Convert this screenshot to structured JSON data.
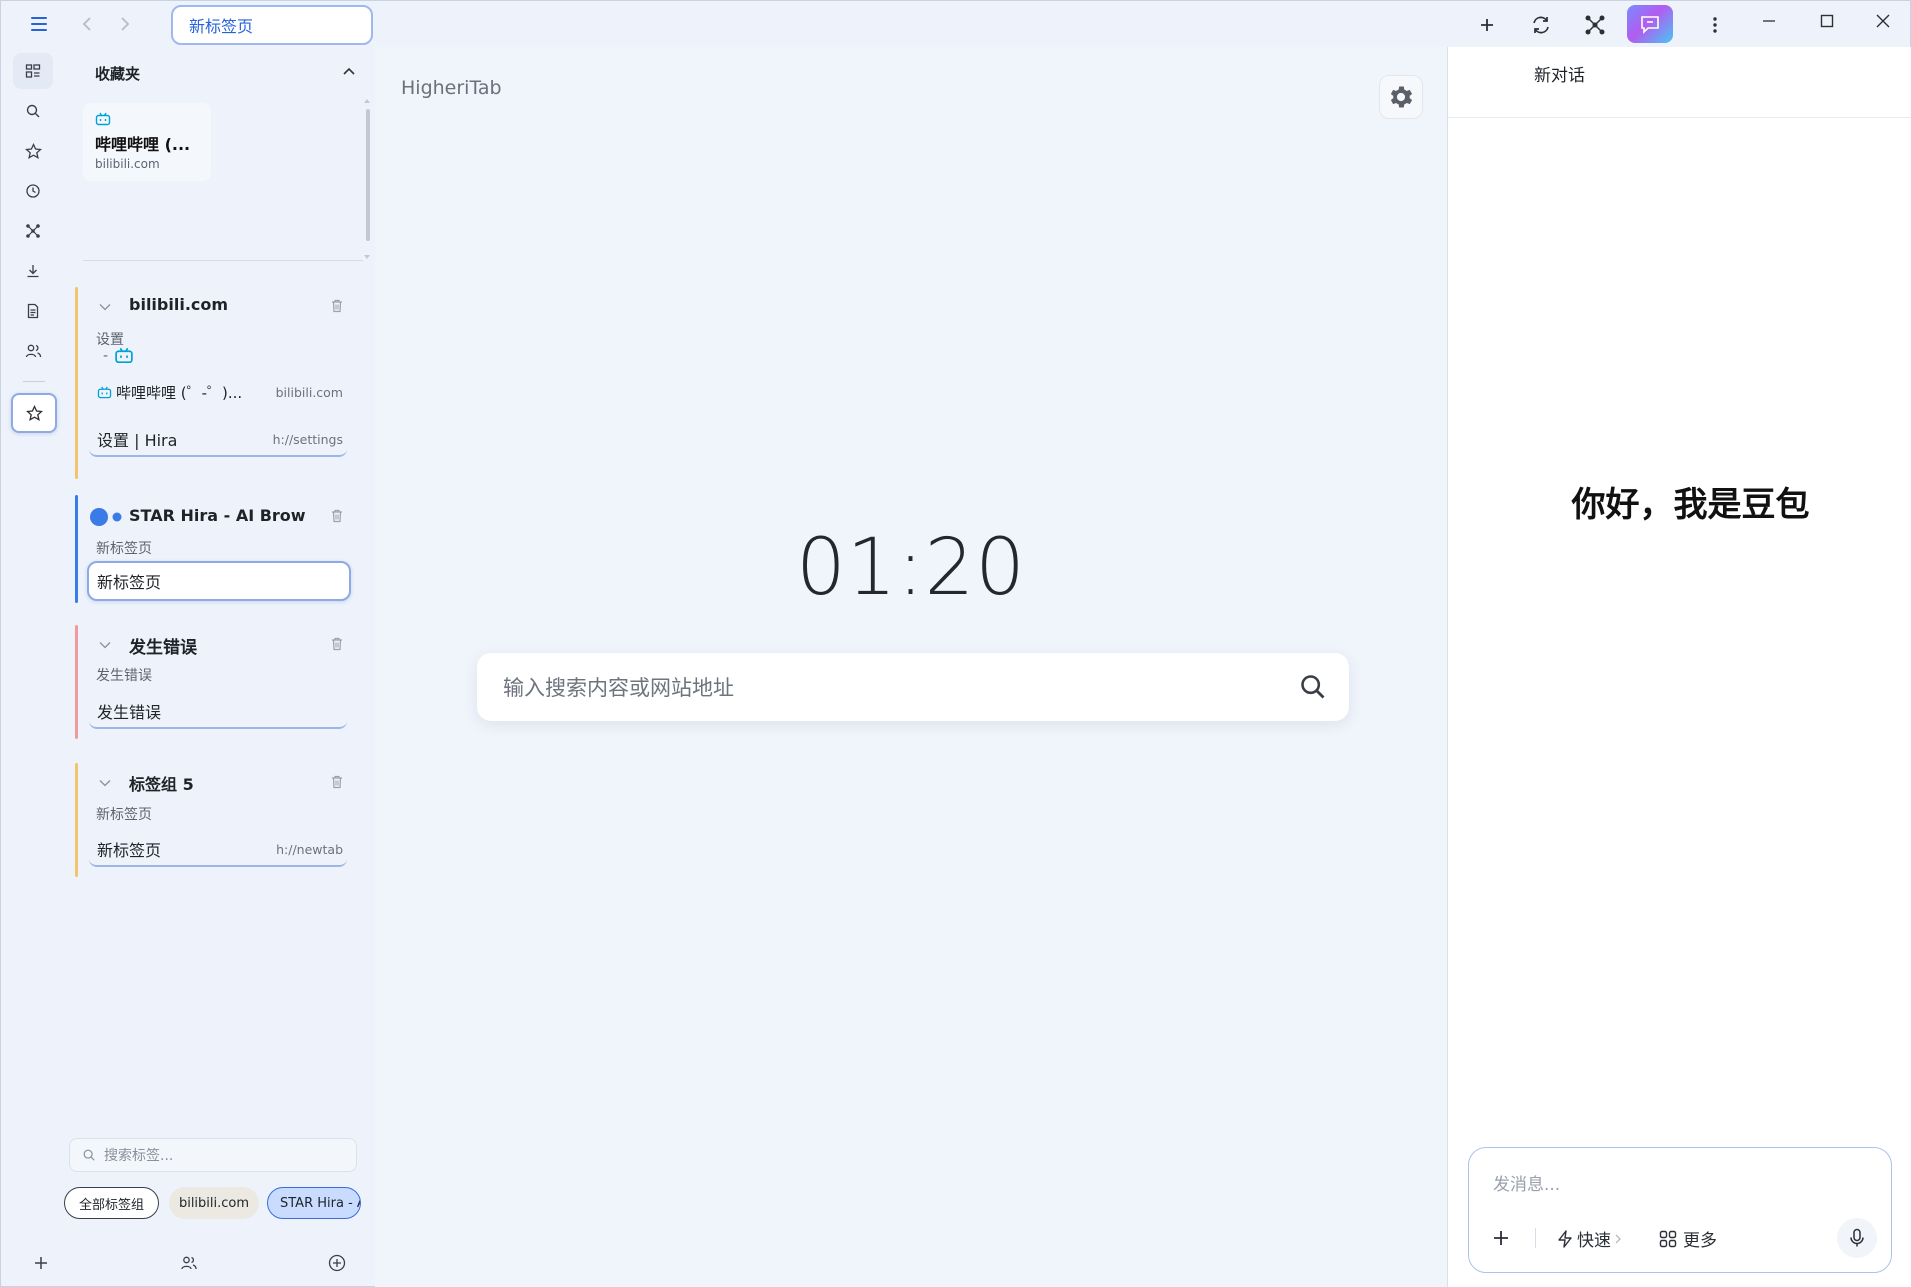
{
  "window": {
    "address_tab": "新标签页",
    "colors": {
      "accent": "#2763d8",
      "chat_gradient": "#b15cf0"
    }
  },
  "rail": {
    "icons": [
      "tabs-icon",
      "search-icon",
      "star-icon",
      "history-icon",
      "nodes-icon",
      "download-icon",
      "document-icon",
      "users-icon",
      "star-icon"
    ]
  },
  "favorites": {
    "heading": "收藏夹",
    "items": [
      {
        "title": "哔哩哔哩 (...",
        "domain": "bilibili.com"
      }
    ]
  },
  "groups": [
    {
      "title": "bilibili.com",
      "color": "#f2c46d",
      "subtitle": "设置",
      "subtitle2": "-",
      "tabs": [
        {
          "title": "哔哩哔哩 (゜-゜)...",
          "url": "bilibili.com"
        },
        {
          "title": "设置 | Hira",
          "url": "h://settings"
        }
      ]
    },
    {
      "title": "STAR Hira - AI Brow",
      "color": "#3a7be8",
      "subtitle": "新标签页",
      "tabs": [
        {
          "title": "新标签页",
          "url": ""
        }
      ]
    },
    {
      "title": "发生错误",
      "color": "#f09aa0",
      "subtitle": "发生错误",
      "tabs": [
        {
          "title": "发生错误",
          "url": ""
        }
      ]
    },
    {
      "title": "标签组 5",
      "color": "#f2c46d",
      "subtitle": "新标签页",
      "tabs": [
        {
          "title": "新标签页",
          "url": "h://newtab"
        }
      ]
    }
  ],
  "tab_search": {
    "placeholder": "搜索标签..."
  },
  "chips": [
    "全部标签组",
    "bilibili.com",
    "STAR Hira - AI Brow"
  ],
  "main": {
    "brand": "HigheriTab",
    "clock": "01:20",
    "search_placeholder": "输入搜索内容或网站地址"
  },
  "chat": {
    "header": "新对话",
    "greeting": "你好，我是豆包",
    "input_placeholder": "发消息...",
    "quick_label": "快速",
    "more_label": "更多"
  }
}
